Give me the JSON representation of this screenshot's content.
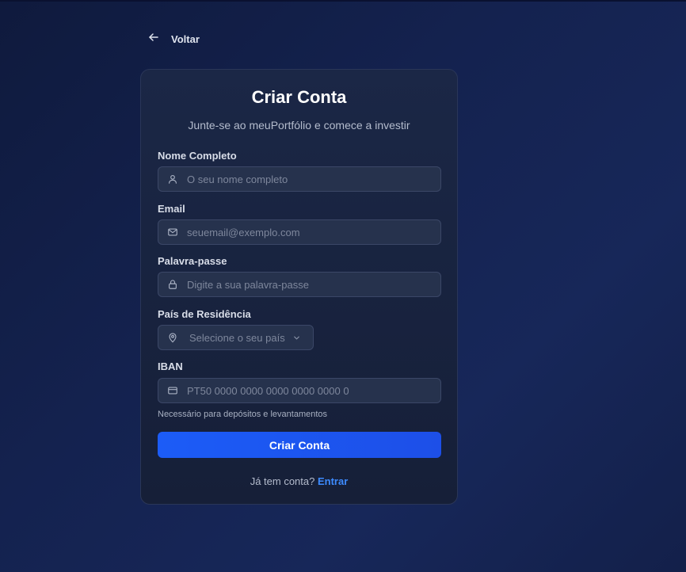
{
  "nav": {
    "back_label": "Voltar"
  },
  "card": {
    "title": "Criar Conta",
    "subtitle": "Junte-se ao meuPortfólio e comece a investir"
  },
  "form": {
    "name": {
      "label": "Nome Completo",
      "placeholder": "O seu nome completo",
      "icon": "user-icon"
    },
    "email": {
      "label": "Email",
      "placeholder": "seuemail@exemplo.com",
      "icon": "mail-icon"
    },
    "password": {
      "label": "Palavra-passe",
      "placeholder": "Digite a sua palavra-passe",
      "icon": "lock-icon"
    },
    "country": {
      "label": "País de Residência",
      "placeholder": "Selecione o seu país",
      "icon": "map-pin-icon"
    },
    "iban": {
      "label": "IBAN",
      "placeholder": "PT50 0000 0000 0000 0000 0000 0",
      "icon": "credit-card-icon",
      "help": "Necessário para depósitos e levantamentos"
    },
    "submit_label": "Criar Conta"
  },
  "footer": {
    "prompt": "Já tem conta?",
    "link_label": "Entrar"
  },
  "colors": {
    "accent": "#1c5cf7",
    "link": "#3d8bff",
    "card_bg": "#1b2746",
    "input_bg": "#26324d"
  }
}
